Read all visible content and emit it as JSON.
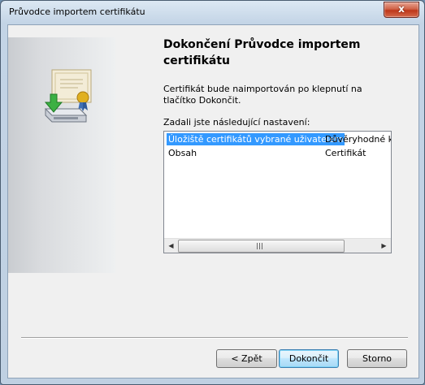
{
  "window": {
    "title": "Průvodce importem certifikátu",
    "close_glyph": "x"
  },
  "page": {
    "heading": "Dokončení Průvodce importem certifikátu",
    "info": "Certifikát bude naimportován po klepnutí na tlačítko Dokončit.",
    "settings_label": "Zadali jste následující nastavení:"
  },
  "settings_list": {
    "rows": [
      {
        "name": "Úložiště certifikátů vybrané uživatelem",
        "value": "Důvěryhodné kořenové certifikační autority",
        "selected": true
      },
      {
        "name": "Obsah",
        "value": "Certifikát",
        "selected": false
      }
    ]
  },
  "buttons": {
    "back": "< Zpět",
    "finish": "Dokončit",
    "cancel": "Storno"
  },
  "icons": {
    "wizard_art": "certificate-import-icon"
  }
}
